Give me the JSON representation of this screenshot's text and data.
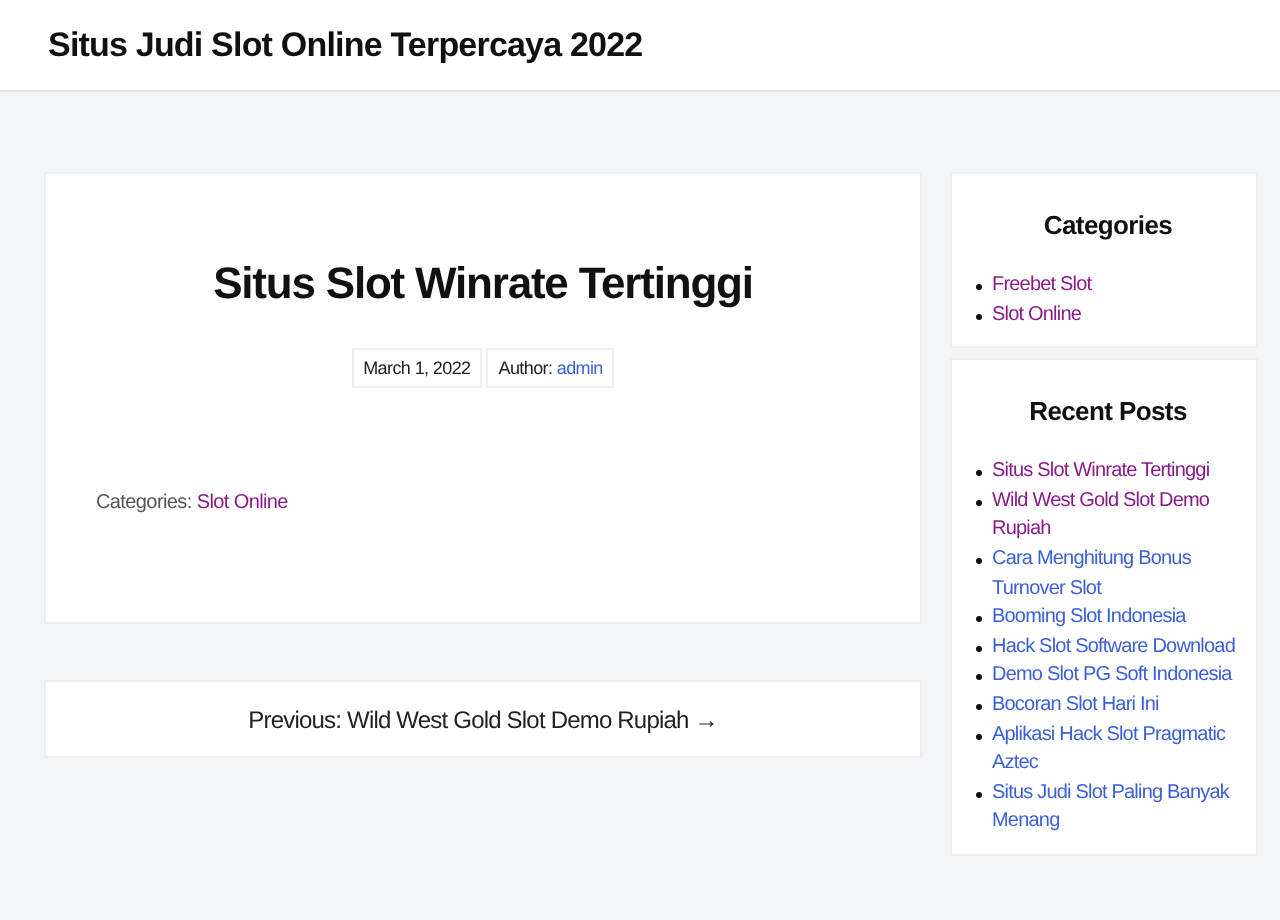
{
  "site_title": "Situs Judi Slot Online Terpercaya 2022",
  "post": {
    "title": "Situs Slot Winrate Tertinggi",
    "date": "March 1, 2022",
    "author_label": "Author:",
    "author": "admin",
    "categories_label": "Categories:",
    "category": {
      "label": "Slot Online",
      "visited": true
    }
  },
  "post_navigation": {
    "label": "Previous: Wild West Gold Slot Demo Rupiah",
    "arrow": "→"
  },
  "sidebar": [
    {
      "title": "Categories",
      "items": [
        {
          "label": "Freebet Slot",
          "visited": true
        },
        {
          "label": "Slot Online",
          "visited": true
        }
      ]
    },
    {
      "title": "Recent Posts",
      "items": [
        {
          "label": "Situs Slot Winrate Tertinggi",
          "visited": true
        },
        {
          "label": "Wild West Gold Slot Demo Rupiah",
          "visited": true
        },
        {
          "label": "Cara Menghitung Bonus Turnover Slot",
          "visited": false
        },
        {
          "label": "Booming Slot Indonesia",
          "visited": false
        },
        {
          "label": "Hack Slot Software Download",
          "visited": false
        },
        {
          "label": "Demo Slot PG Soft Indonesia",
          "visited": false
        },
        {
          "label": "Bocoran Slot Hari Ini",
          "visited": false
        },
        {
          "label": "Aplikasi Hack Slot Pragmatic Aztec",
          "visited": false
        },
        {
          "label": "Situs Judi Slot Paling Banyak Menang",
          "visited": false
        }
      ]
    }
  ]
}
